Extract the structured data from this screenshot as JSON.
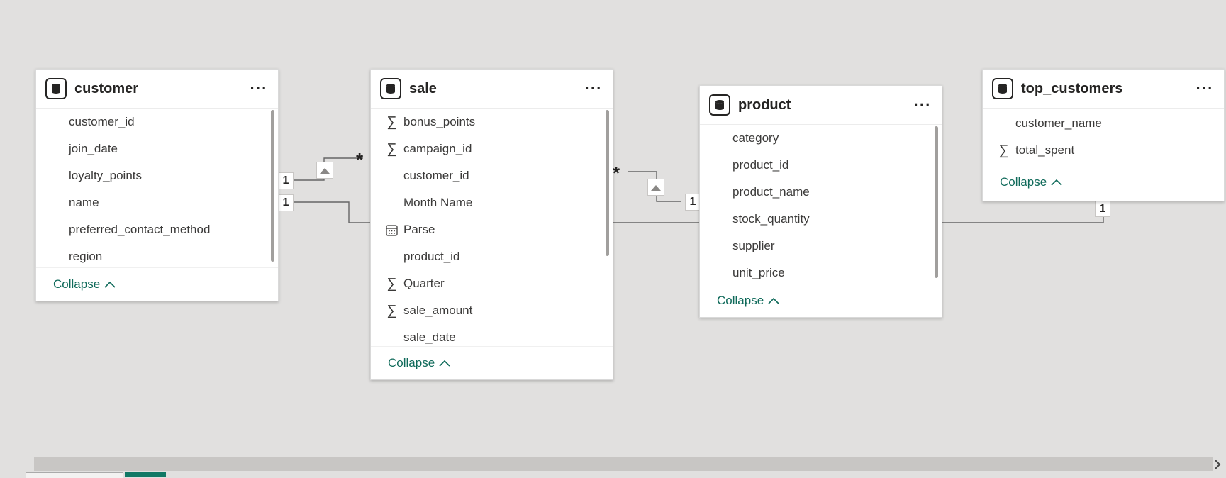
{
  "tables": {
    "customer": {
      "title": "customer",
      "more": "···",
      "fields": [
        "customer_id",
        "join_date",
        "loyalty_points",
        "name",
        "preferred_contact_method",
        "region"
      ],
      "collapse": "Collapse"
    },
    "sale": {
      "title": "sale",
      "more": "···",
      "fields": [
        {
          "name": "bonus_points",
          "icon": "sigma-icon"
        },
        {
          "name": "campaign_id",
          "icon": "sigma-icon"
        },
        {
          "name": "customer_id",
          "icon": ""
        },
        {
          "name": "Month Name",
          "icon": ""
        },
        {
          "name": "Parse",
          "icon": "calendar-icon"
        },
        {
          "name": "product_id",
          "icon": ""
        },
        {
          "name": "Quarter",
          "icon": "sigma-icon"
        },
        {
          "name": "sale_amount",
          "icon": "sigma-icon"
        },
        {
          "name": "sale_date",
          "icon": ""
        }
      ],
      "collapse": "Collapse"
    },
    "product": {
      "title": "product",
      "more": "···",
      "fields": [
        "category",
        "product_id",
        "product_name",
        "stock_quantity",
        "supplier",
        "unit_price"
      ],
      "collapse": "Collapse"
    },
    "top_customers": {
      "title": "top_customers",
      "more": "···",
      "fields": [
        {
          "name": "customer_name",
          "icon": ""
        },
        {
          "name": "total_spent",
          "icon": "sigma-icon"
        }
      ],
      "collapse": "Collapse"
    }
  },
  "relationships": {
    "one": "1",
    "many": "*"
  },
  "colors": {
    "canvas": "#e1e0df",
    "accent": "#0f6a5a",
    "scrollbar": "#c8c6c4",
    "bottom_tab_active": "#117865"
  }
}
